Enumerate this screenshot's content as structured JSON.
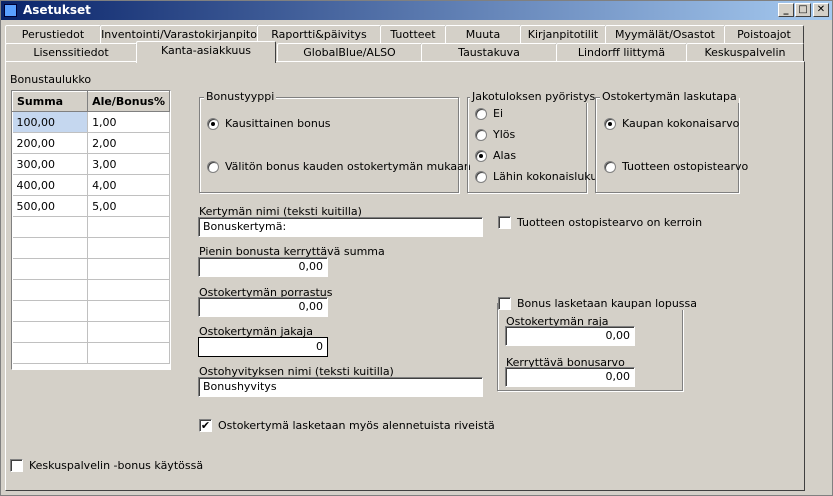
{
  "window": {
    "title": "Asetukset"
  },
  "tabs_row1": [
    "Perustiedot",
    "Inventointi/Varastokirjanpito",
    "Raportti&päivitys",
    "Tuotteet",
    "Muuta",
    "Kirjanpitotilit",
    "Myymälät/Osastot",
    "Poistoajot"
  ],
  "tabs_row2": [
    "Lisenssitiedot",
    "Kanta-asiakkuus",
    "GlobalBlue/ALSO",
    "Taustakuva",
    "Lindorff liittymä",
    "Keskuspalvelin"
  ],
  "bonus_table": {
    "label": "Bonustaulukko",
    "headers": [
      "Summa",
      "Ale/Bonus%"
    ],
    "rows": [
      [
        "100,00",
        "1,00"
      ],
      [
        "200,00",
        "2,00"
      ],
      [
        "300,00",
        "3,00"
      ],
      [
        "400,00",
        "4,00"
      ],
      [
        "500,00",
        "5,00"
      ]
    ]
  },
  "bonus_type": {
    "title": "Bonustyyppi",
    "options": [
      "Kausittainen bonus",
      "Välitön bonus kauden ostokertymän mukaan"
    ]
  },
  "rounding": {
    "title": "Jakotuloksen pyöristys",
    "options": [
      "Ei",
      "Ylös",
      "Alas",
      "Lähin kokonaisluku"
    ]
  },
  "calc_method": {
    "title": "Ostokertymän laskutapa",
    "options": [
      "Kaupan kokonaisarvo",
      "Tuotteen ostopistearvo"
    ]
  },
  "fields": {
    "accum_name_label": "Kertymän nimi (teksti kuitilla)",
    "accum_name_value": "Bonuskertymä:",
    "min_sum_label": "Pienin bonusta kerryttävä summa",
    "min_sum_value": "0,00",
    "step_label": "Ostokertymän porrastus",
    "step_value": "0,00",
    "divider_label": "Ostokertymän jakaja",
    "divider_value": "0",
    "refund_name_label": "Ostohyvityksen nimi (teksti kuitilla)",
    "refund_name_value": "Bonushyvitys"
  },
  "checks": {
    "points_multiplier": "Tuotteen ostopistearvo on kerroin",
    "discounted_rows": "Ostokertymä lasketaan myös alennetuista riveistä",
    "central_bonus": "Keskuspalvelin -bonus käytössä",
    "end_of_sale": "Bonus lasketaan kaupan lopussa"
  },
  "end_of_sale_group": {
    "limit_label": "Ostokertymän raja",
    "limit_value": "0,00",
    "accrued_label": "Kerryttävä bonusarvo",
    "accrued_value": "0,00"
  },
  "icons": {
    "check_mark": "✔",
    "minimize": "_",
    "maximize": "□",
    "close": "✕"
  }
}
